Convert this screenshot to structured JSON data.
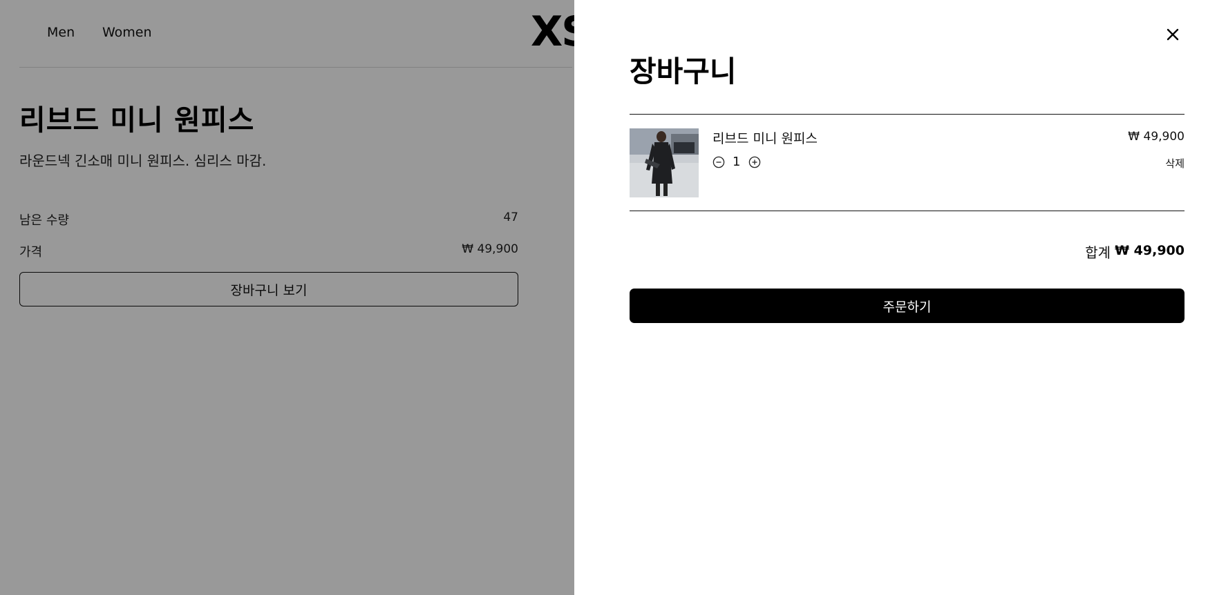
{
  "header": {
    "nav": [
      {
        "label": "Men"
      },
      {
        "label": "Women"
      }
    ],
    "logo": "XS"
  },
  "product": {
    "title": "리브드 미니 원피스",
    "description": "라운드넥 긴소매 미니 원피스. 심리스 마감.",
    "stock_label": "남은 수량",
    "stock_value": "47",
    "price_label": "가격",
    "price_value": "₩ 49,900",
    "view_cart_label": "장바구니 보기"
  },
  "cart": {
    "title": "장바구니",
    "close_icon": "close-icon",
    "items": [
      {
        "name": "리브드 미니 원피스",
        "quantity": "1",
        "price": "₩ 49,900",
        "delete_label": "삭제",
        "thumbnail": "product-photo"
      }
    ],
    "total_label": "합계",
    "total_value": "₩ 49,900",
    "order_label": "주문하기"
  },
  "colors": {
    "overlay": "#999999",
    "drawer_bg": "#ffffff",
    "primary_button": "#000000"
  }
}
